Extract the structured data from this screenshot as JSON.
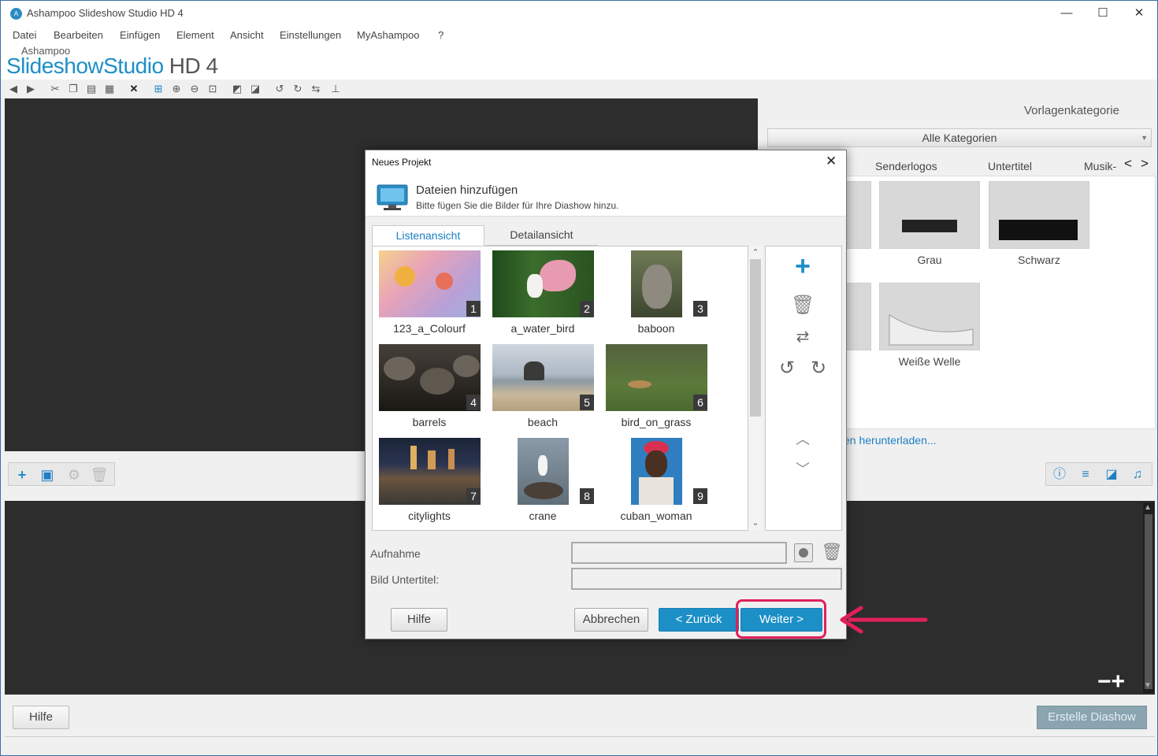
{
  "window": {
    "title": "Ashampoo Slideshow Studio HD 4",
    "minimize": "—",
    "maximize": "☐",
    "close": "✕"
  },
  "menu": [
    "Datei",
    "Bearbeiten",
    "Einfügen",
    "Element",
    "Ansicht",
    "Einstellungen",
    "MyAshampoo",
    "?"
  ],
  "brand": {
    "small": "Ashampoo",
    "main": "SlideshowStudio",
    "suffix": " HD 4"
  },
  "right_panel": {
    "category_label": "Vorlagenkategorie",
    "category_value": "Alle Kategorien",
    "tabs": [
      "Senderlogos",
      "Untertitel",
      "Musik-"
    ],
    "tiles": [
      "Grau",
      "Schwarz",
      "Weiße Welle"
    ],
    "download_link": "en herunterladen..."
  },
  "buttons": {
    "hilfe": "Hilfe",
    "erstelle": "Erstelle Diashow"
  },
  "dialog": {
    "title": "Neues Projekt",
    "header_title": "Dateien hinzufügen",
    "header_sub": "Bitte fügen Sie die Bilder für Ihre Diashow hinzu.",
    "tabs": {
      "list": "Listenansicht",
      "detail": "Detailansicht"
    },
    "images": [
      {
        "num": "1",
        "name": "123_a_Colourf"
      },
      {
        "num": "2",
        "name": "a_water_bird"
      },
      {
        "num": "3",
        "name": "baboon"
      },
      {
        "num": "4",
        "name": "barrels"
      },
      {
        "num": "5",
        "name": "beach"
      },
      {
        "num": "6",
        "name": "bird_on_grass"
      },
      {
        "num": "7",
        "name": "citylights"
      },
      {
        "num": "8",
        "name": "crane"
      },
      {
        "num": "9",
        "name": "cuban_woman"
      }
    ],
    "labels": {
      "aufnahme": "Aufnahme",
      "untertitel": "Bild Untertitel:"
    },
    "buttons": {
      "hilfe": "Hilfe",
      "abbrechen": "Abbrechen",
      "zurueck": "< Zurück",
      "weiter": "Weiter >"
    }
  },
  "annotation_color": "#e0205a",
  "accent_color": "#1c8fc7"
}
